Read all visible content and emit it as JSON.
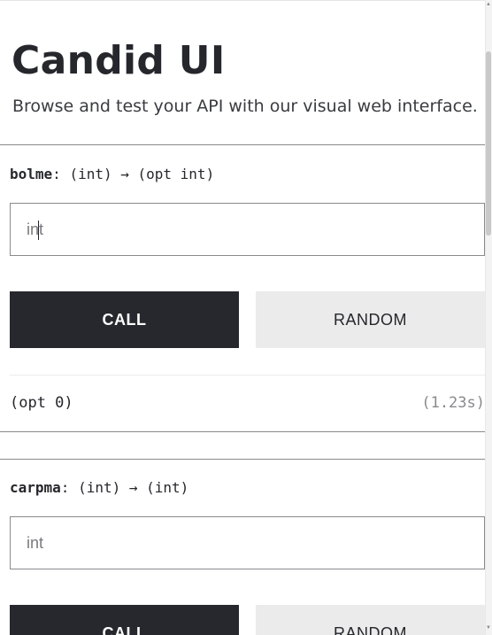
{
  "header": {
    "title": "Candid UI",
    "subtitle": "Browse and test your API with our visual web interface."
  },
  "methods": [
    {
      "name": "bolme",
      "signature": ": (int) → (opt int)",
      "input_placeholder": "int",
      "input_value": "",
      "call_label": "CALL",
      "random_label": "RANDOM",
      "result_value": "(opt 0)",
      "result_time": "(1.23s)"
    },
    {
      "name": "carpma",
      "signature": ": (int) → (int)",
      "input_placeholder": "int",
      "input_value": "",
      "call_label": "CALL",
      "random_label": "RANDOM"
    }
  ],
  "colors": {
    "call_button_bg": "#27282d",
    "random_button_bg": "#ebebeb",
    "text": "#26272c",
    "muted": "#8a8a8e"
  },
  "icons": {
    "scroll_up": "triangle-up",
    "scroll_down": "triangle-down"
  }
}
